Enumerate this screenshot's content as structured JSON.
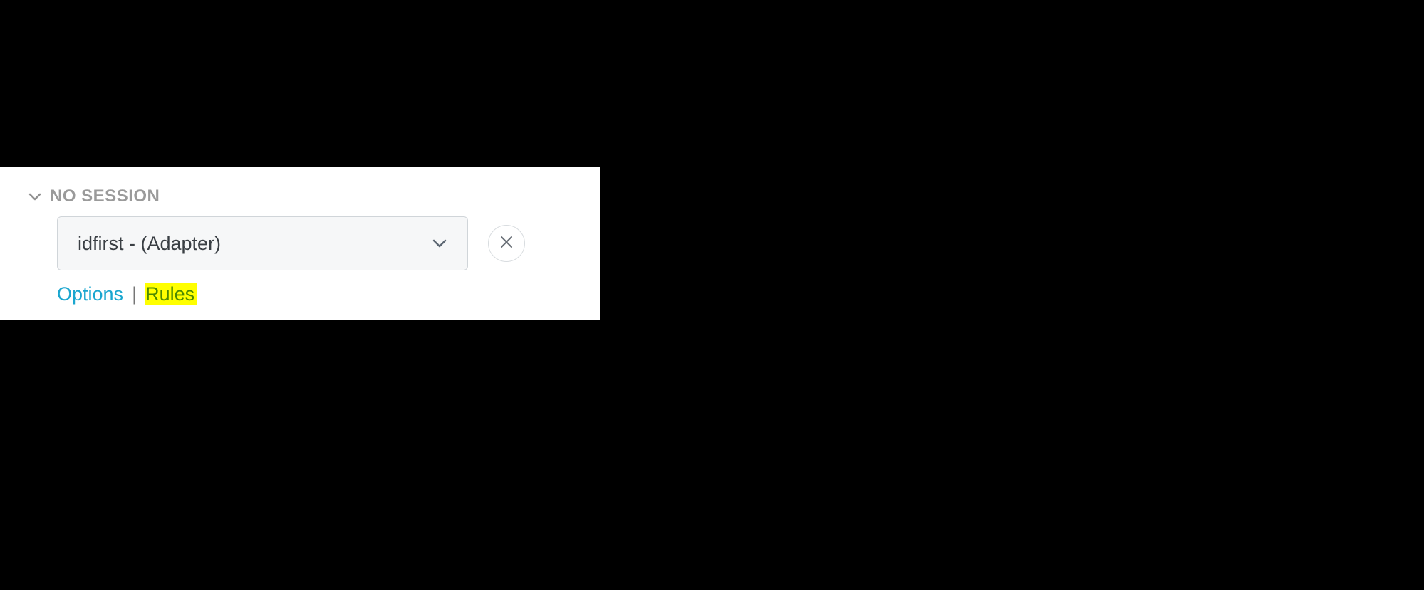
{
  "section": {
    "title": "NO SESSION"
  },
  "select": {
    "value": "idfirst - (Adapter)"
  },
  "links": {
    "options": "Options",
    "separator": "|",
    "rules": "Rules"
  }
}
